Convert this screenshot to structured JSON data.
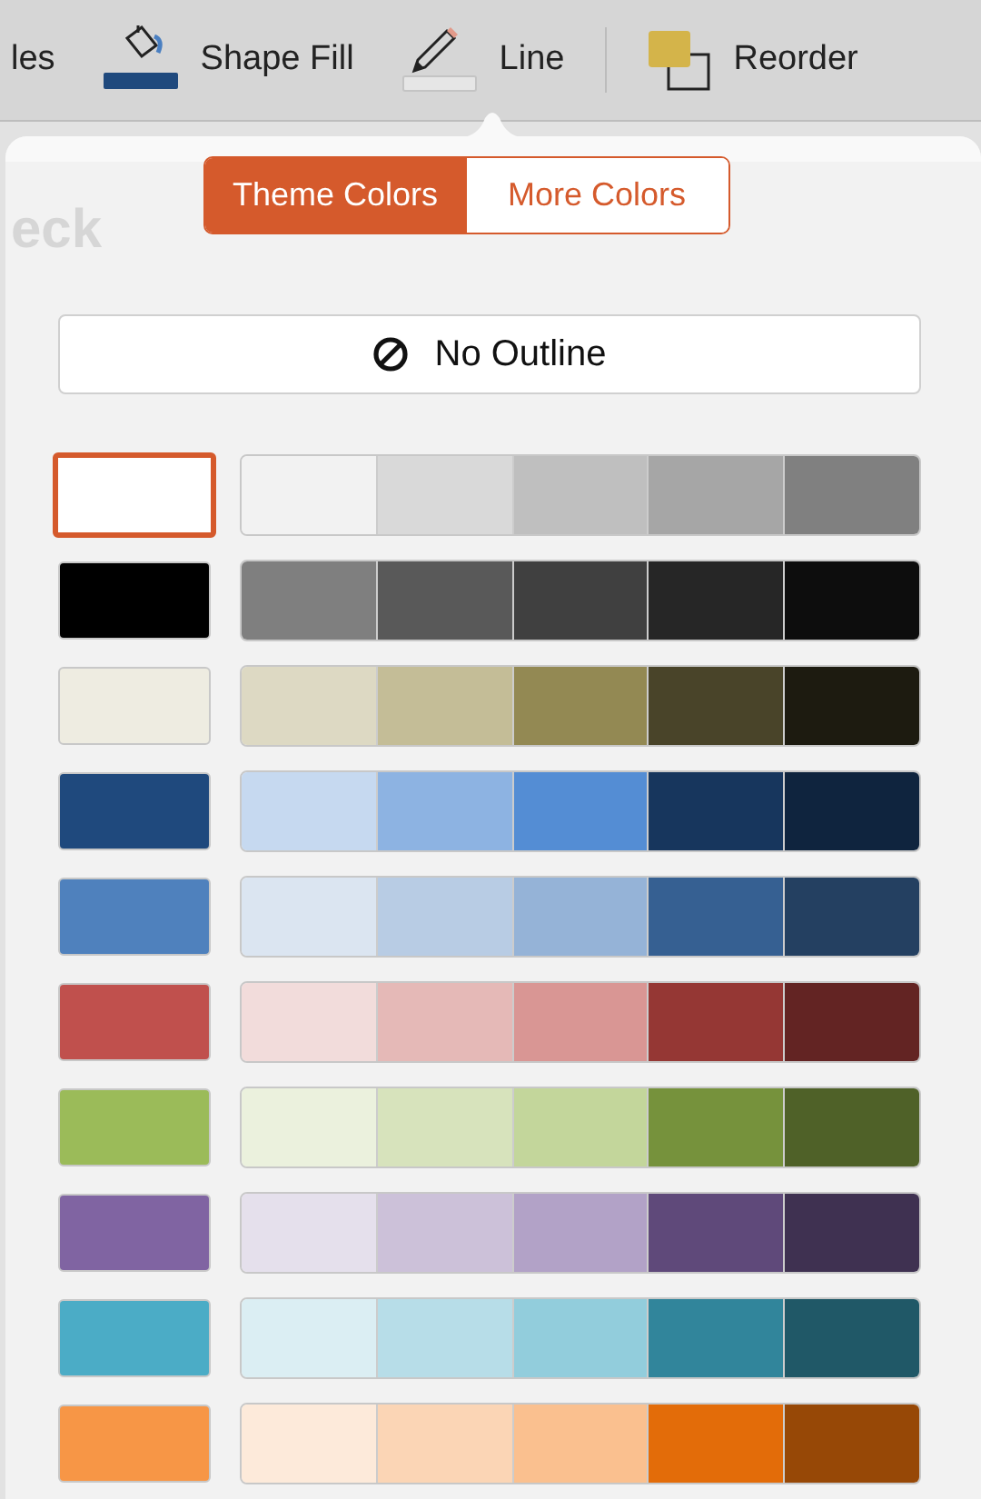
{
  "toolbar": {
    "items": [
      {
        "kind": "text",
        "label": "les"
      },
      {
        "kind": "fill",
        "label": "Shape Fill"
      },
      {
        "kind": "line",
        "label": "Line"
      },
      {
        "kind": "divider"
      },
      {
        "kind": "reorder",
        "label": "Reorder"
      }
    ]
  },
  "background_text": "eck",
  "popover": {
    "tabs": [
      {
        "label": "Theme Colors",
        "selected": true
      },
      {
        "label": "More Colors",
        "selected": false
      }
    ],
    "no_outline": {
      "label": "No Outline"
    },
    "rows": [
      {
        "color": "#ffffff",
        "selected": true,
        "shades": [
          {
            "color": "#f2f2f2",
            "selected": false
          },
          {
            "color": "#d9d9d9",
            "selected": false
          },
          {
            "color": "#bfbfbf",
            "selected": false
          },
          {
            "color": "#a6a6a6",
            "selected": false
          },
          {
            "color": "#808080",
            "selected": false
          }
        ]
      },
      {
        "color": "#000000",
        "selected": false,
        "shades": [
          {
            "color": "#7f7f7f",
            "selected": false
          },
          {
            "color": "#595959",
            "selected": false
          },
          {
            "color": "#404040",
            "selected": false
          },
          {
            "color": "#262626",
            "selected": false
          },
          {
            "color": "#0d0d0d",
            "selected": false
          }
        ]
      },
      {
        "color": "#eeece1",
        "selected": false,
        "shades": [
          {
            "color": "#ddd9c3",
            "selected": false
          },
          {
            "color": "#c4bd97",
            "selected": false
          },
          {
            "color": "#938953",
            "selected": false
          },
          {
            "color": "#494429",
            "selected": false
          },
          {
            "color": "#1d1b10",
            "selected": false
          }
        ]
      },
      {
        "color": "#1f497d",
        "selected": false,
        "shades": [
          {
            "color": "#c6d9f0",
            "selected": false
          },
          {
            "color": "#8db3e2",
            "selected": false
          },
          {
            "color": "#548dd4",
            "selected": false
          },
          {
            "color": "#17365d",
            "selected": false
          },
          {
            "color": "#0f243e",
            "selected": false
          }
        ]
      },
      {
        "color": "#4f81bd",
        "selected": false,
        "shades": [
          {
            "color": "#dbe5f1",
            "selected": false
          },
          {
            "color": "#b8cce4",
            "selected": false
          },
          {
            "color": "#95b3d7",
            "selected": false
          },
          {
            "color": "#366092",
            "selected": false
          },
          {
            "color": "#244061",
            "selected": false
          }
        ]
      },
      {
        "color": "#c0504d",
        "selected": false,
        "shades": [
          {
            "color": "#f2dcdb",
            "selected": false
          },
          {
            "color": "#e5b9b7",
            "selected": false
          },
          {
            "color": "#d99694",
            "selected": false
          },
          {
            "color": "#953734",
            "selected": false
          },
          {
            "color": "#632423",
            "selected": false
          }
        ]
      },
      {
        "color": "#9bbb59",
        "selected": false,
        "shades": [
          {
            "color": "#ebf1dd",
            "selected": false
          },
          {
            "color": "#d7e3bc",
            "selected": false
          },
          {
            "color": "#c3d69b",
            "selected": false
          },
          {
            "color": "#76923c",
            "selected": false
          },
          {
            "color": "#4f6128",
            "selected": false
          }
        ]
      },
      {
        "color": "#8064a2",
        "selected": false,
        "shades": [
          {
            "color": "#e5e0ec",
            "selected": false
          },
          {
            "color": "#ccc1d9",
            "selected": false
          },
          {
            "color": "#b2a2c7",
            "selected": false
          },
          {
            "color": "#5f497a",
            "selected": false
          },
          {
            "color": "#3f3151",
            "selected": false
          }
        ]
      },
      {
        "color": "#4bacc6",
        "selected": false,
        "shades": [
          {
            "color": "#dbeef3",
            "selected": false
          },
          {
            "color": "#b7dde8",
            "selected": false
          },
          {
            "color": "#92cddc",
            "selected": false
          },
          {
            "color": "#31859b",
            "selected": false
          },
          {
            "color": "#205867",
            "selected": false
          }
        ]
      },
      {
        "color": "#f79646",
        "selected": false,
        "shades": [
          {
            "color": "#fdeada",
            "selected": false
          },
          {
            "color": "#fbd5b5",
            "selected": false
          },
          {
            "color": "#fac08f",
            "selected": false
          },
          {
            "color": "#e36c09",
            "selected": false
          },
          {
            "color": "#974806",
            "selected": false
          }
        ]
      }
    ]
  }
}
